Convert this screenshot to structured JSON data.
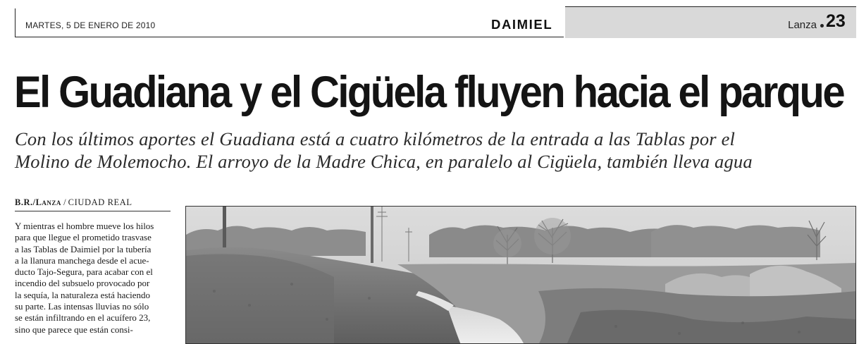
{
  "header": {
    "date": "MARTES, 5 DE ENERO DE 2010",
    "section": "DAIMIEL",
    "paper": "Lanza",
    "page_number": "23"
  },
  "article": {
    "headline": "El Guadiana y el Cigüela fluyen hacia el parque",
    "subheadline_lines": [
      "Con los últimos aportes el Guadiana está a cuatro kilómetros de la entrada a las Tablas por el",
      "Molino de Molemocho. El arroyo de la Madre Chica, en paralelo al Cigüela, también lleva agua"
    ],
    "byline": {
      "author": "B.R./Lanza",
      "separator": "/",
      "location": "CIUDAD REAL"
    },
    "body_lines": [
      "Y mientras el hombre mueve los hilos",
      "para que llegue el prometido trasvase",
      "a las Tablas de Daimiel por la tubería",
      "a la llanura manchega desde el acue-",
      "ducto Tajo-Segura, para acabar con el",
      "incendio del subsuelo provocado por",
      "la sequía, la naturaleza está haciendo",
      "su parte. Las intensas lluvias no sólo",
      "se están infiltrando en el acuífero 23,",
      "sino que parece que están consi-"
    ]
  },
  "photo": {
    "subject": "river-landscape-photo"
  }
}
